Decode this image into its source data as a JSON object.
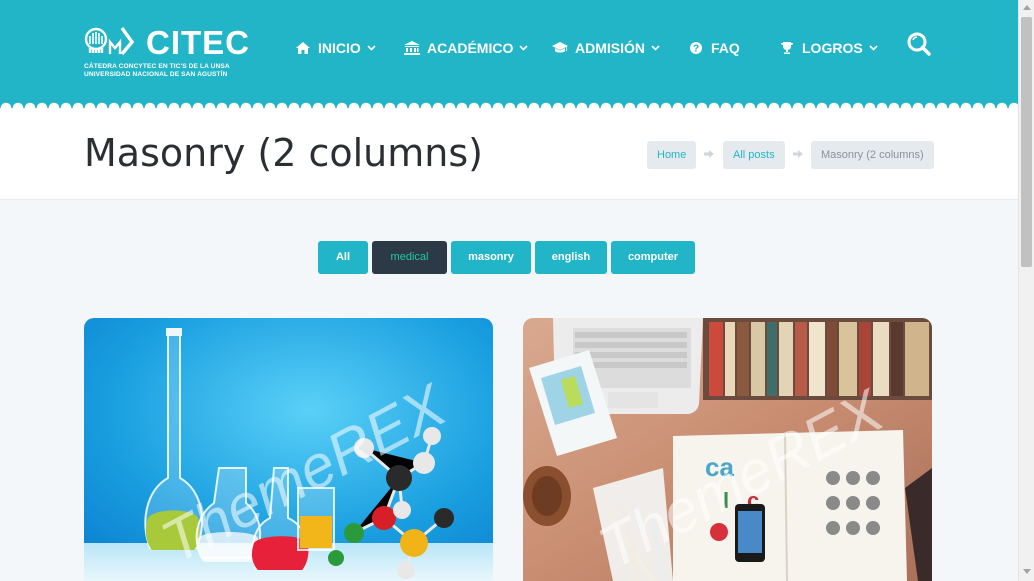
{
  "logo": {
    "name": "CITEC",
    "subtitle_line1": "CÁTEDRA CONCYTEC EN TIC'S DE LA UNSA",
    "subtitle_line2": "UNIVERSIDAD NACIONAL DE SAN AGUSTÍN"
  },
  "nav": {
    "items": [
      {
        "label": "INICIO",
        "icon": "home-icon",
        "has_dropdown": true
      },
      {
        "label": "ACADÉMICO",
        "icon": "institution-icon",
        "has_dropdown": true
      },
      {
        "label": "ADMISIÓN",
        "icon": "graduation-cap-icon",
        "has_dropdown": true
      },
      {
        "label": "FAQ",
        "icon": "question-circle-icon",
        "has_dropdown": false
      },
      {
        "label": "LOGROS",
        "icon": "trophy-icon",
        "has_dropdown": true
      }
    ],
    "search_icon": "search-icon"
  },
  "page": {
    "title": "Masonry (2 columns)"
  },
  "breadcrumb": {
    "home": "Home",
    "all_posts": "All posts",
    "current": "Masonry (2 columns)"
  },
  "filters": {
    "items": [
      "All",
      "medical",
      "masonry",
      "english",
      "computer"
    ],
    "active": "medical"
  },
  "posts": [
    {
      "image": "chemistry-flasks-molecule-image",
      "watermark": "ThemeREX"
    },
    {
      "image": "desk-laptop-books-magazine-image",
      "watermark": "ThemeREX"
    }
  ],
  "colors": {
    "brand": "#22b5c8",
    "active_filter_bg": "#2b3a46",
    "active_filter_text": "#22c8a0",
    "title_text": "#2b2f33"
  }
}
